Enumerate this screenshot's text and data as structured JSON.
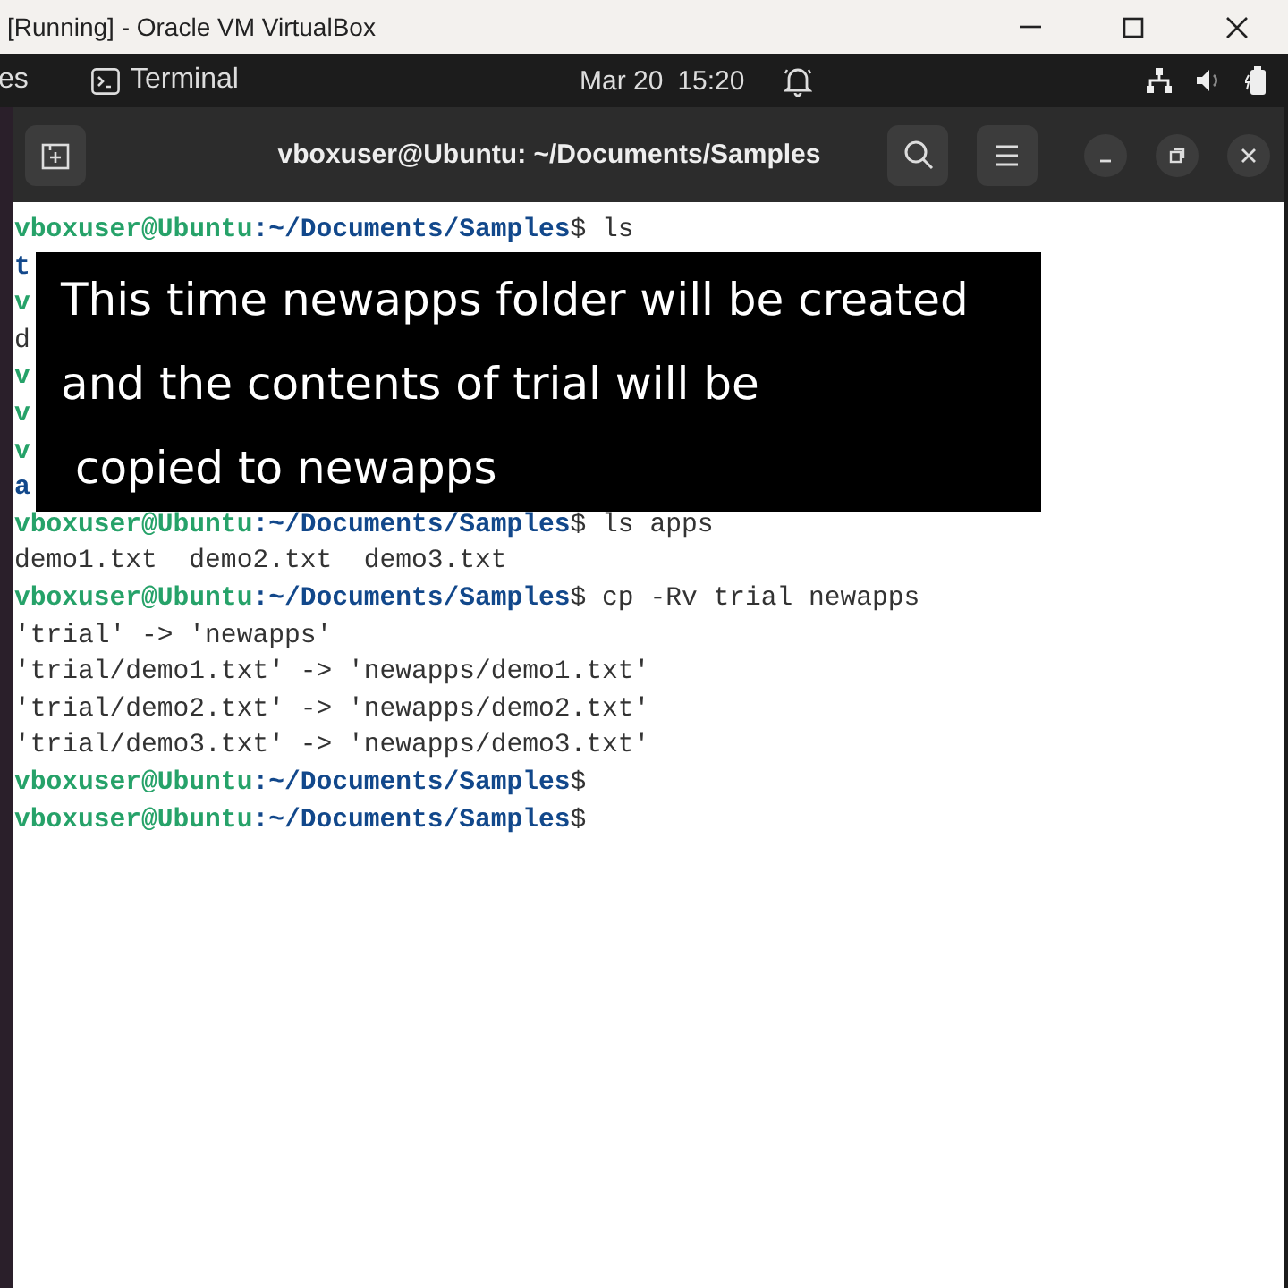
{
  "window": {
    "title": "[Running] - Oracle VM VirtualBox"
  },
  "top_bar": {
    "activities": "es",
    "app": "Terminal",
    "date": "Mar 20",
    "time": "15:20"
  },
  "terminal": {
    "title": "vboxuser@Ubuntu: ~/Documents/Samples",
    "lines": [
      {
        "kind": "prompt",
        "user": "vboxuser@Ubuntu",
        "path": ":~/Documents/Samples",
        "command": "$ ls"
      },
      {
        "kind": "dir",
        "text": "t"
      },
      {
        "kind": "prompt",
        "user": "v"
      },
      {
        "kind": "output",
        "text": "d"
      },
      {
        "kind": "prompt",
        "user": "v"
      },
      {
        "kind": "prompt",
        "user": "v"
      },
      {
        "kind": "prompt",
        "user": "v"
      },
      {
        "kind": "dir",
        "text": "a"
      },
      {
        "kind": "prompt",
        "user": "vboxuser@Ubuntu",
        "path": ":~/Documents/Samples",
        "command": "$ ls apps"
      },
      {
        "kind": "output",
        "text": "demo1.txt  demo2.txt  demo3.txt"
      },
      {
        "kind": "prompt",
        "user": "vboxuser@Ubuntu",
        "path": ":~/Documents/Samples",
        "command": "$ cp -Rv trial newapps"
      },
      {
        "kind": "output",
        "text": "'trial' -> 'newapps'"
      },
      {
        "kind": "output",
        "text": "'trial/demo1.txt' -> 'newapps/demo1.txt'"
      },
      {
        "kind": "output",
        "text": "'trial/demo2.txt' -> 'newapps/demo2.txt'"
      },
      {
        "kind": "output",
        "text": "'trial/demo3.txt' -> 'newapps/demo3.txt'"
      },
      {
        "kind": "prompt",
        "user": "vboxuser@Ubuntu",
        "path": ":~/Documents/Samples",
        "command": "$"
      },
      {
        "kind": "prompt",
        "user": "vboxuser@Ubuntu",
        "path": ":~/Documents/Samples",
        "command": "$"
      }
    ]
  },
  "caption": {
    "lines": [
      "This time newapps folder will be created",
      "and the contents of trial will be",
      " copied to newapps"
    ]
  }
}
